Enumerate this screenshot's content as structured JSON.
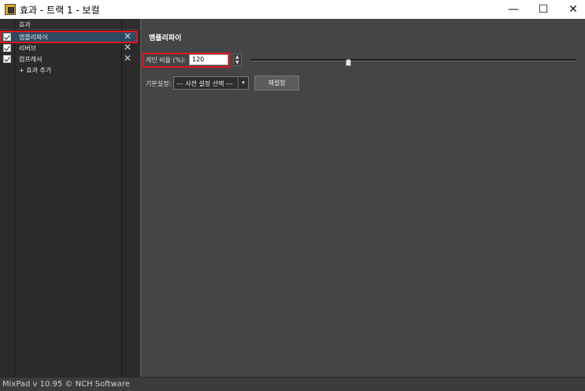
{
  "window": {
    "title": "효과 - 트랙 1 - 보컬",
    "minimize_glyph": "—",
    "maximize_glyph": "☐",
    "close_glyph": "✕"
  },
  "effects_panel": {
    "header": "효과",
    "items": [
      {
        "label": "앰플리파이",
        "checked": true,
        "selected": true
      },
      {
        "label": "리버브",
        "checked": true,
        "selected": false
      },
      {
        "label": "컴프레서",
        "checked": true,
        "selected": false
      }
    ],
    "remove_glyph": "✕",
    "add_label": "+ 효과 추가"
  },
  "amplify": {
    "title": "앰플리파이",
    "gain_label": "게인 비율 (%):",
    "gain_value": "120",
    "spin_up": "▲",
    "spin_down": "▼",
    "slider_level_fraction": 0.3,
    "preset_label": "기본설정:",
    "preset_value": "--- 사전 설정 선택 ---",
    "preset_arrow": "▾",
    "reset_label": "재설정"
  },
  "status": {
    "text": "MixPad v 10.95 © NCH Software"
  },
  "colors": {
    "highlight": "#e0161c",
    "selection": "#2d4a63",
    "panel_bg": "#454545",
    "sidebar_bg": "#2b2b2b"
  }
}
